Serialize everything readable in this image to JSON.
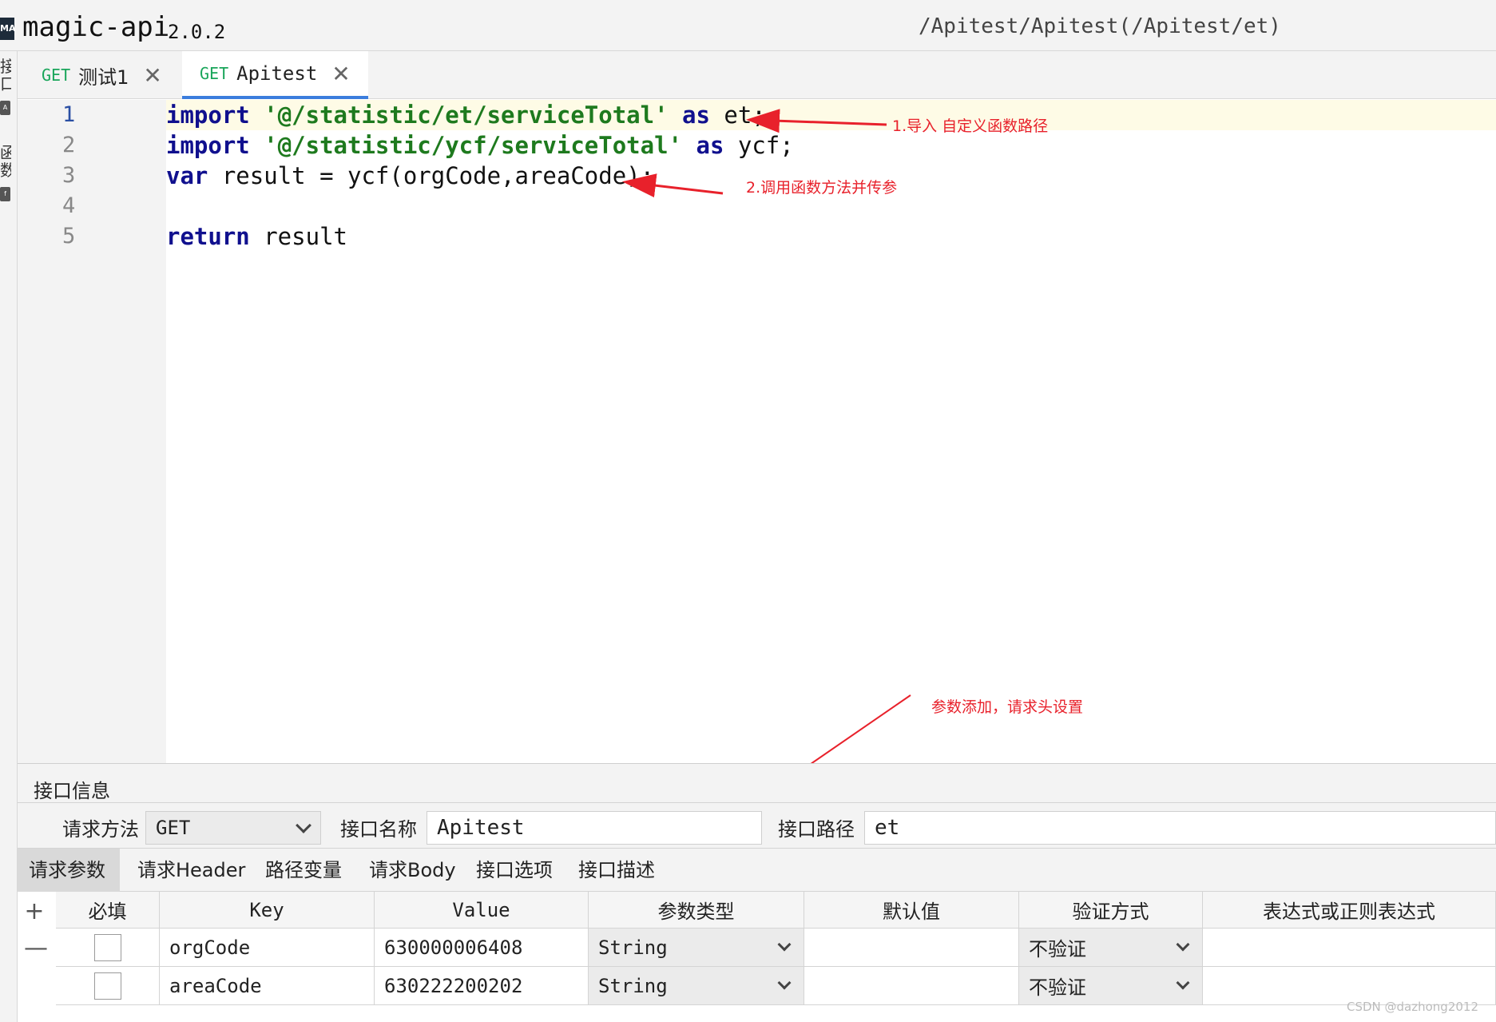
{
  "header": {
    "logo_text": "MA",
    "title": "magic-api",
    "version": "2.0.2",
    "path": "/Apitest/Apitest(/Apitest/et)"
  },
  "left_strip": {
    "chars": [
      "接",
      "口",
      "函",
      "数"
    ],
    "icons": [
      "api-icon",
      "function-icon"
    ]
  },
  "tabs": [
    {
      "method": "GET",
      "label": "测试1",
      "active": false
    },
    {
      "method": "GET",
      "label": "Apitest",
      "active": true
    }
  ],
  "editor": {
    "line_numbers": [
      "1",
      "2",
      "3",
      "4",
      "5"
    ],
    "lines": [
      [
        {
          "t": "import",
          "c": "kw"
        },
        {
          "t": " ",
          "c": ""
        },
        {
          "t": "'@/statistic/et/serviceTotal'",
          "c": "str"
        },
        {
          "t": " ",
          "c": ""
        },
        {
          "t": "as",
          "c": "kw"
        },
        {
          "t": " et;",
          "c": ""
        }
      ],
      [
        {
          "t": "import",
          "c": "kw"
        },
        {
          "t": " ",
          "c": ""
        },
        {
          "t": "'@/statistic/ycf/serviceTotal'",
          "c": "str"
        },
        {
          "t": " ",
          "c": ""
        },
        {
          "t": "as",
          "c": "kw"
        },
        {
          "t": " ycf;",
          "c": ""
        }
      ],
      [
        {
          "t": "var",
          "c": "kw"
        },
        {
          "t": " result = ycf(orgCode,areaCode);",
          "c": ""
        }
      ],
      [],
      [
        {
          "t": "return",
          "c": "kw"
        },
        {
          "t": " result",
          "c": ""
        }
      ]
    ]
  },
  "annotations": {
    "note1": "1.导入 自定义函数路径",
    "note2": "2.调用函数方法并传参",
    "note3": "参数添加，请求头设置"
  },
  "info": {
    "title": "接口信息",
    "method_label": "请求方法",
    "method_value": "GET",
    "name_label": "接口名称",
    "name_value": "Apitest",
    "path_label": "接口路径",
    "path_value": "et"
  },
  "sub_tabs": [
    "请求参数",
    "请求Header",
    "路径变量",
    "请求Body",
    "接口选项",
    "接口描述"
  ],
  "table": {
    "tools": [
      "+",
      "—"
    ],
    "headers": [
      "必填",
      "Key",
      "Value",
      "参数类型",
      "默认值",
      "验证方式",
      "表达式或正则表达式"
    ],
    "rows": [
      {
        "required": false,
        "key": "orgCode",
        "value": "630000006408",
        "type": "String",
        "default": "",
        "validation": "不验证",
        "expression": ""
      },
      {
        "required": false,
        "key": "areaCode",
        "value": "630222200202",
        "type": "String",
        "default": "",
        "validation": "不验证",
        "expression": ""
      }
    ]
  },
  "colors": {
    "accent": "#3b7ddd",
    "method_green": "#19a55a",
    "keyword": "#10108e",
    "string": "#1e7a1e",
    "annotation_red": "#e8212b"
  },
  "watermark": "CSDN @dazhong2012"
}
